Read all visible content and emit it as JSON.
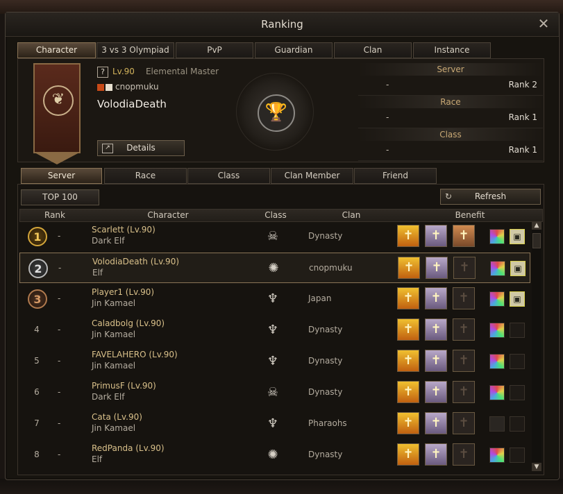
{
  "window": {
    "title": "Ranking"
  },
  "top_tabs": [
    {
      "label": "Character",
      "active": true
    },
    {
      "label": "3 vs 3 Olympiad"
    },
    {
      "label": "PvP"
    },
    {
      "label": "Guardian"
    },
    {
      "label": "Clan"
    },
    {
      "label": "Instance"
    }
  ],
  "profile": {
    "level": "Lv.90",
    "class": "Elemental Master",
    "clan": "cnopmuku",
    "name": "VolodiaDeath",
    "details_label": "Details",
    "help_glyph": "?"
  },
  "stats": [
    {
      "label": "Server",
      "dash": "-",
      "rank": "Rank 2"
    },
    {
      "label": "Race",
      "dash": "-",
      "rank": "Rank 1"
    },
    {
      "label": "Class",
      "dash": "-",
      "rank": "Rank 1"
    }
  ],
  "list_tabs": [
    {
      "label": "Server",
      "active": true
    },
    {
      "label": "Race"
    },
    {
      "label": "Class"
    },
    {
      "label": "Clan Member"
    },
    {
      "label": "Friend"
    }
  ],
  "toolbar": {
    "top100_label": "TOP 100",
    "refresh_label": "Refresh"
  },
  "table": {
    "headers": {
      "rank": "Rank",
      "character": "Character",
      "class": "Class",
      "clan": "Clan",
      "benefit": "Benefit"
    },
    "rows": [
      {
        "rank": "1",
        "dash": "-",
        "name": "Scarlett (Lv.90)",
        "race": "Dark Elf",
        "clan": "Dynasty",
        "class_icon": "skull-crest-icon",
        "medal": "gold",
        "gift": true,
        "third_benefit": true,
        "gem": true
      },
      {
        "rank": "2",
        "dash": "-",
        "name": "VolodiaDeath (Lv.90)",
        "race": "Elf",
        "clan": "cnopmuku",
        "class_icon": "sun-crest-icon",
        "medal": "silver",
        "gift": true,
        "third_benefit": false,
        "gem": true,
        "selected": true
      },
      {
        "rank": "3",
        "dash": "-",
        "name": "Player1 (Lv.90)",
        "race": "Jin Kamael",
        "clan": "Japan",
        "class_icon": "demon-crest-icon",
        "medal": "bronze",
        "gift": true,
        "third_benefit": false,
        "gem": true
      },
      {
        "rank": "4",
        "dash": "-",
        "name": "Caladbolg (Lv.90)",
        "race": "Jin Kamael",
        "clan": "Dynasty",
        "class_icon": "demon-crest-icon",
        "gift": false,
        "third_benefit": false,
        "gem": true
      },
      {
        "rank": "5",
        "dash": "-",
        "name": "FAVELAHERO (Lv.90)",
        "race": "Jin Kamael",
        "clan": "Dynasty",
        "class_icon": "demon-crest-icon",
        "gift": false,
        "third_benefit": false,
        "gem": true
      },
      {
        "rank": "6",
        "dash": "-",
        "name": "PrimusF (Lv.90)",
        "race": "Dark Elf",
        "clan": "Dynasty",
        "class_icon": "skull-crest-icon",
        "gift": false,
        "third_benefit": false,
        "gem": true
      },
      {
        "rank": "7",
        "dash": "-",
        "name": "Cata (Lv.90)",
        "race": "Jin Kamael",
        "clan": "Pharaohs",
        "class_icon": "demon-crest-icon",
        "gift": false,
        "third_benefit": false,
        "gem": false
      },
      {
        "rank": "8",
        "dash": "-",
        "name": "RedPanda (Lv.90)",
        "race": "Elf",
        "clan": "Dynasty",
        "class_icon": "sun-crest-icon",
        "gift": false,
        "third_benefit": false,
        "gem": true
      }
    ]
  }
}
